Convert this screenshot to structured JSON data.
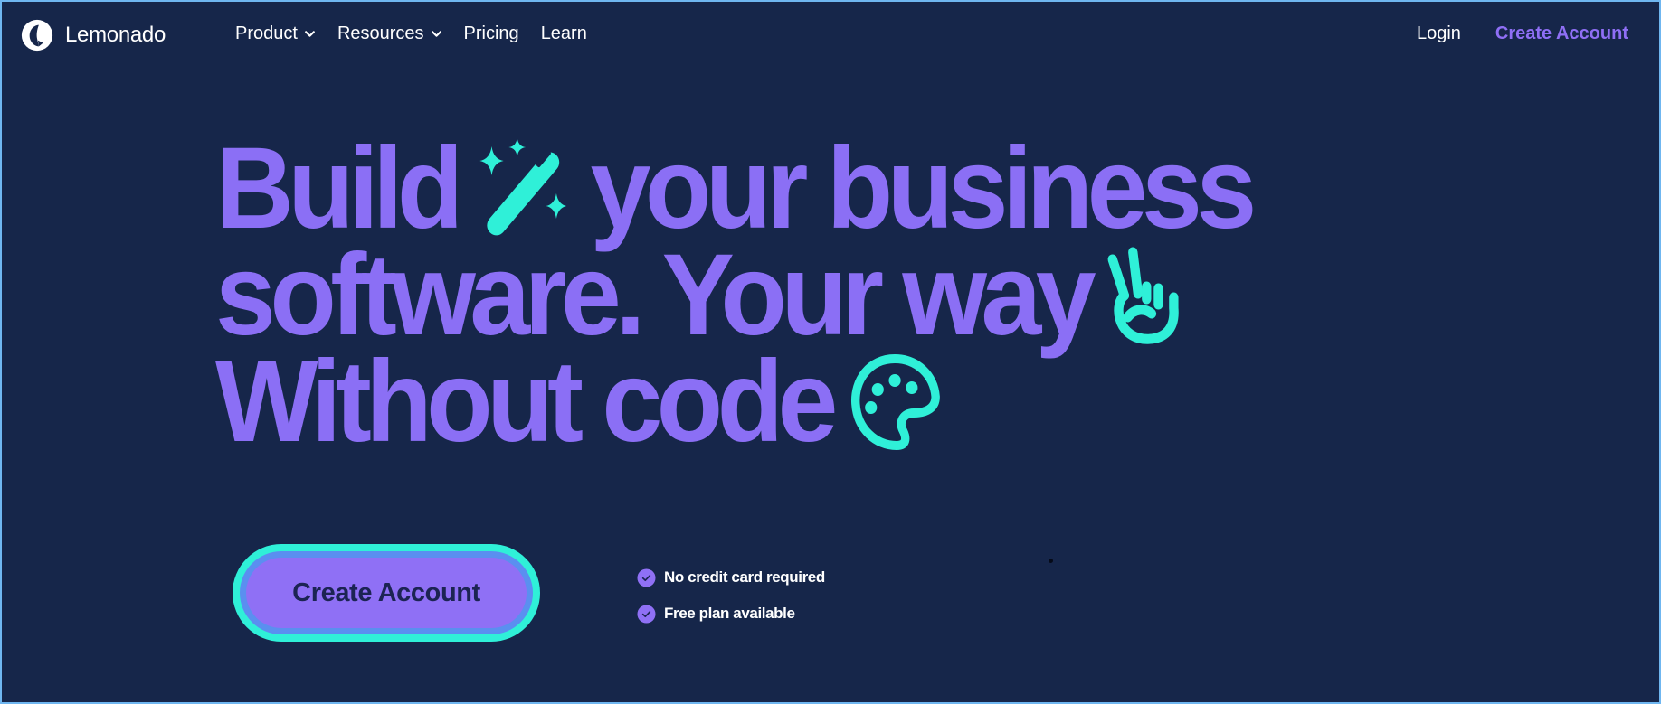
{
  "brand": {
    "name": "Lemonado",
    "logo_icon": "lemonado-logo-icon"
  },
  "nav": {
    "items": [
      {
        "label": "Product",
        "has_dropdown": true
      },
      {
        "label": "Resources",
        "has_dropdown": true
      },
      {
        "label": "Pricing",
        "has_dropdown": false
      },
      {
        "label": "Learn",
        "has_dropdown": false
      }
    ],
    "login_label": "Login",
    "create_account_label": "Create Account"
  },
  "hero": {
    "line1": {
      "word1": "Build",
      "icon": "magic-wand-icon",
      "word2": "your business"
    },
    "line2": {
      "text": "software. Your way",
      "icon": "victory-hand-icon"
    },
    "line3": {
      "text": "Without code",
      "icon": "palette-icon"
    },
    "cta_label": "Create Account",
    "benefits": [
      {
        "icon": "check-circle-icon",
        "label": "No credit card required"
      },
      {
        "icon": "check-circle-icon",
        "label": "Free plan available"
      }
    ]
  },
  "colors": {
    "background": "#16264a",
    "headline": "#8b6ff5",
    "accent_teal": "#2ff0d8",
    "accent_purple": "#8f70f5",
    "frame_border": "#6fb6f0"
  }
}
